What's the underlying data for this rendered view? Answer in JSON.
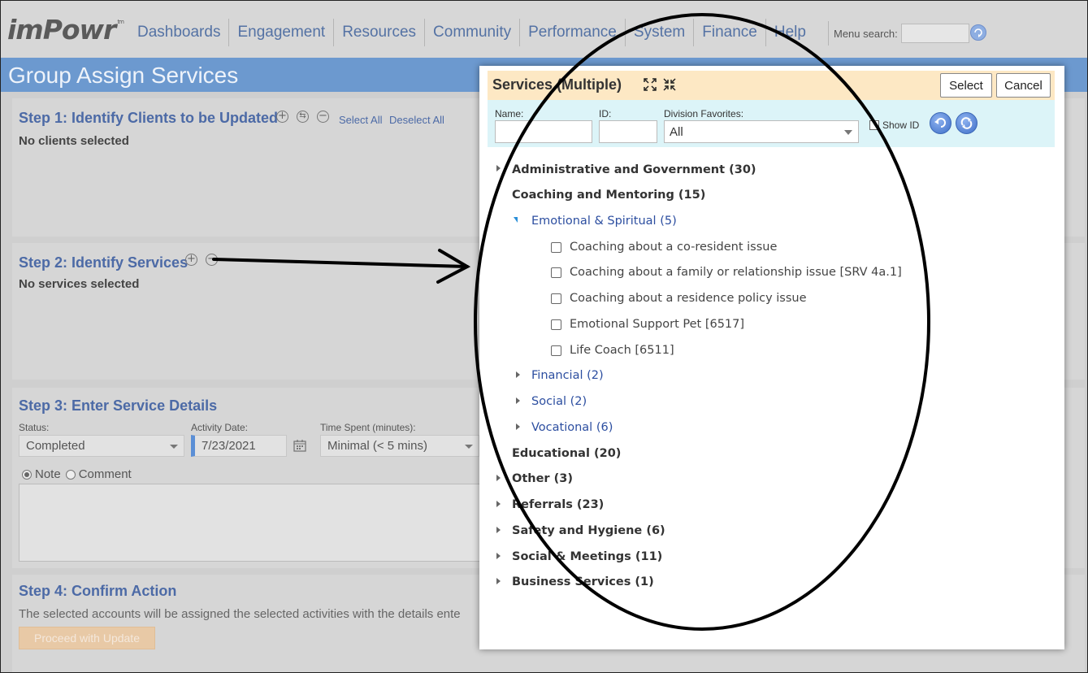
{
  "logo": {
    "text": "imPowr",
    "tm": "tm"
  },
  "nav": {
    "items": [
      "Dashboards",
      "Engagement",
      "Resources",
      "Community",
      "Performance",
      "System",
      "Finance",
      "Help"
    ],
    "menu_search_label": "Menu search:"
  },
  "page_title": "Group Assign Services",
  "step1": {
    "title": "Step 1: Identify Clients to be Updated",
    "select_all": "Select All",
    "deselect_all": "Deselect All",
    "status": "No clients selected"
  },
  "step2": {
    "title": "Step 2: Identify Services",
    "status": "No services selected"
  },
  "step3": {
    "title": "Step 3: Enter Service Details",
    "status_label": "Status:",
    "status_value": "Completed",
    "activity_date_label": "Activity Date:",
    "activity_date_value": "7/23/2021",
    "time_spent_label": "Time Spent (minutes):",
    "time_spent_value": "Minimal (< 5 mins)",
    "note_label": "Note",
    "comment_label": "Comment"
  },
  "step4": {
    "title": "Step 4: Confirm Action",
    "description": "The selected accounts will be assigned the selected activities with the details ente",
    "proceed_label": "Proceed with Update"
  },
  "modal": {
    "title": "Services (Multiple)",
    "select_label": "Select",
    "cancel_label": "Cancel",
    "name_label": "Name:",
    "id_label": "ID:",
    "division_label": "Division Favorites:",
    "division_value": "All",
    "show_id_label": "Show ID",
    "tree": {
      "cat_admin": "Administrative and Government (30)",
      "cat_coaching": "Coaching and Mentoring (15)",
      "sub_emotional": "Emotional & Spiritual (5)",
      "leaf_1": "Coaching about a co-resident issue",
      "leaf_2": "Coaching about a family or relationship issue [SRV 4a.1]",
      "leaf_3": "Coaching about a residence policy issue",
      "leaf_4": "Emotional Support Pet [6517]",
      "leaf_5": "Life Coach [6511]",
      "sub_financial": "Financial (2)",
      "sub_social": "Social (2)",
      "sub_vocational": "Vocational (6)",
      "cat_educational": "Educational (20)",
      "cat_other": "Other (3)",
      "cat_referrals": "Referrals (23)",
      "cat_safety": "Safety and Hygiene (6)",
      "cat_social_meetings": "Social & Meetings (11)",
      "cat_business": "Business Services (1)"
    }
  },
  "colors": {
    "nav_link": "#5472a4",
    "title_bar": "#6c99cf",
    "modal_header": "#fde8c4",
    "filter_bar": "#dcf4f8",
    "tree_sub": "#2c4ea0"
  },
  "icons": [
    "expand-icon",
    "collapse-icon",
    "undo-icon",
    "refresh-icon",
    "calendar-icon",
    "add-circle-icon",
    "remove-circle-icon",
    "swap-circle-icon",
    "go-icon"
  ]
}
